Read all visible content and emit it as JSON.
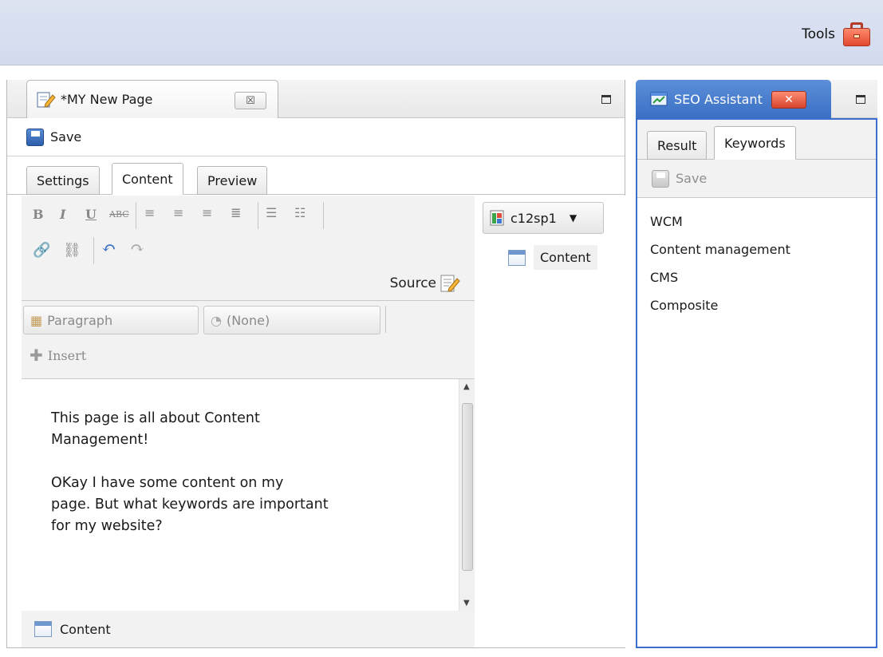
{
  "topbar": {
    "tools_label": "Tools"
  },
  "editor": {
    "tab_title": "*MY New Page",
    "tab_close": "☒",
    "save_label": "Save",
    "subtabs": [
      "Settings",
      "Content",
      "Preview"
    ],
    "active_subtab": "Content",
    "source_label": "Source",
    "paragraph_style": "Paragraph",
    "class_style": "(None)",
    "insert_label": "Insert",
    "text": "This page is all about Content\nManagement!\n\nOKay I have some content on my\npage. But what keywords are important\nfor my website?",
    "footer_label": "Content"
  },
  "template": {
    "selector_value": "c12sp1",
    "tree_item": "Content"
  },
  "seo": {
    "tab_title": "SEO Assistant",
    "subtabs": [
      "Result",
      "Keywords"
    ],
    "active_subtab": "Keywords",
    "save_label": "Save",
    "keywords": [
      "WCM",
      "Content management",
      "CMS",
      "Composite"
    ]
  },
  "colors": {
    "accent_blue": "#3a6fc4",
    "close_red": "#d7442c",
    "topbar": "#d6ddef"
  }
}
